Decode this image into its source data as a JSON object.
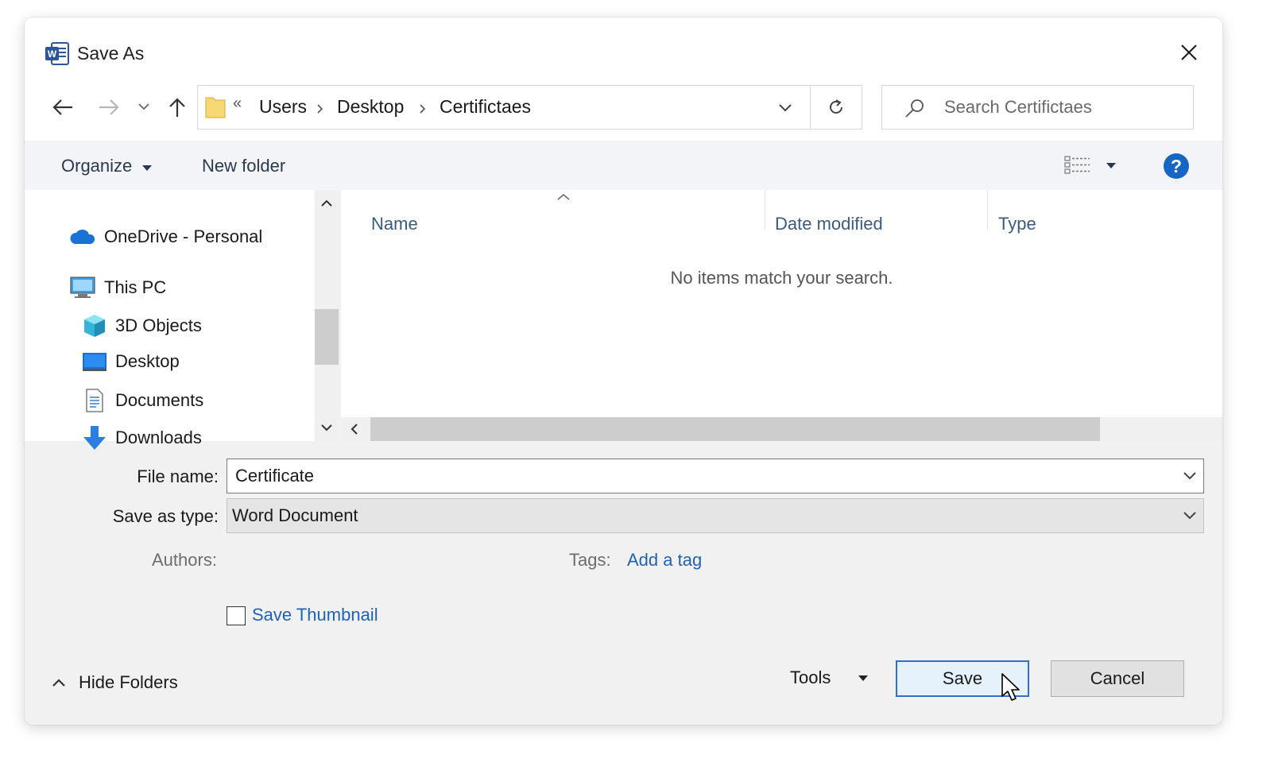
{
  "window": {
    "title": "Save As",
    "app_icon": "word-icon"
  },
  "address_bar": {
    "overflow": "«",
    "path": [
      "Users",
      "Desktop",
      "Certifictaes"
    ]
  },
  "search": {
    "placeholder": "Search Certifictaes"
  },
  "toolbar": {
    "organize_label": "Organize",
    "new_folder_label": "New folder"
  },
  "nav_pane": {
    "items": [
      {
        "label": "OneDrive - Personal",
        "icon": "onedrive-icon"
      },
      {
        "label": "This PC",
        "icon": "pc-icon"
      },
      {
        "label": "3D Objects",
        "icon": "cube-icon"
      },
      {
        "label": "Desktop",
        "icon": "desktop-icon"
      },
      {
        "label": "Documents",
        "icon": "document-icon"
      },
      {
        "label": "Downloads",
        "icon": "download-icon"
      }
    ]
  },
  "file_list": {
    "columns": [
      "Name",
      "Date modified",
      "Type"
    ],
    "empty_message": "No items match your search."
  },
  "form": {
    "file_name_label": "File name:",
    "file_name_value": "Certificate",
    "save_type_label": "Save as type:",
    "save_type_value": "Word Document",
    "authors_label": "Authors:",
    "tags_label": "Tags:",
    "tags_link": "Add a tag",
    "thumbnail_label": "Save Thumbnail",
    "thumbnail_checked": false
  },
  "footer": {
    "hide_folders_label": "Hide Folders",
    "tools_label": "Tools",
    "save_label": "Save",
    "cancel_label": "Cancel"
  },
  "colors": {
    "accent": "#1e63b8",
    "help": "#1766c4",
    "save_border": "#2f6fd0",
    "save_bg": "#e5f1fb"
  }
}
